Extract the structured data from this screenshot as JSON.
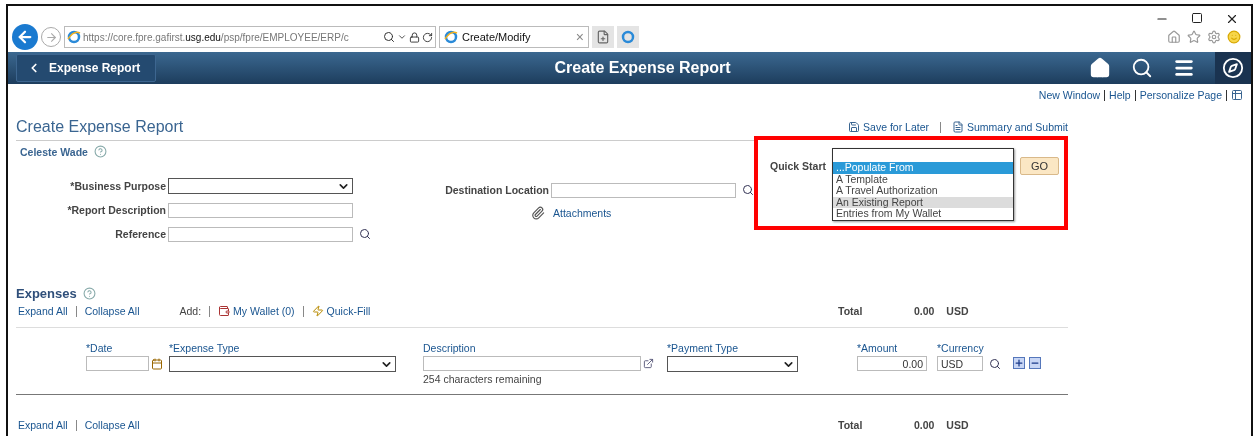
{
  "browser": {
    "address": "https://core.fpre.gafirst.**usg.edu**/psp/fpre/EMPLOYEE/ERP/c",
    "tab_title": "Create/Modify",
    "tab_close": "×"
  },
  "navbar": {
    "back_label": "Expense Report",
    "title": "Create Expense Report"
  },
  "top_links": [
    "New Window",
    "Help",
    "Personalize Page"
  ],
  "page_title": "Create Expense Report",
  "actions": [
    "Save for Later",
    "Summary and Submit"
  ],
  "employee": "Celeste Wade",
  "fields": [
    {
      "label": "*Business Purpose",
      "kind": "select"
    },
    {
      "label": "*Report Description",
      "kind": "text"
    },
    {
      "label": "Reference",
      "kind": "lookup"
    }
  ],
  "destination": {
    "label": "Destination Location"
  },
  "attachments": "Attachments",
  "quick_start": {
    "label": "Quick Start",
    "go": "GO",
    "options": [
      {
        "label": "...Populate From",
        "selected": true,
        "highlighted": false
      },
      {
        "label": "A Template",
        "selected": false,
        "highlighted": false
      },
      {
        "label": "A Travel Authorization",
        "selected": false,
        "highlighted": false
      },
      {
        "label": "An Existing Report",
        "selected": false,
        "highlighted": true
      },
      {
        "label": "Entries from My Wallet",
        "selected": false,
        "highlighted": false
      }
    ]
  },
  "expenses": {
    "title": "Expenses",
    "expand": "Expand All",
    "collapse": "Collapse All",
    "add_label": "Add:",
    "wallet": "My Wallet (0)",
    "quick_fill": "Quick-Fill",
    "total_label": "Total",
    "total": "0.00",
    "total_currency": "USD",
    "columns": [
      "*Date",
      "*Expense Type",
      "Description",
      "*Payment Type",
      "*Amount",
      "*Currency"
    ],
    "row": {
      "amount": "0.00",
      "currency": "USD",
      "remaining": "254 characters remaining"
    }
  },
  "footer": {
    "expand": "Expand All",
    "collapse": "Collapse All",
    "total_label": "Total",
    "total": "0.00",
    "total_currency": "USD"
  }
}
